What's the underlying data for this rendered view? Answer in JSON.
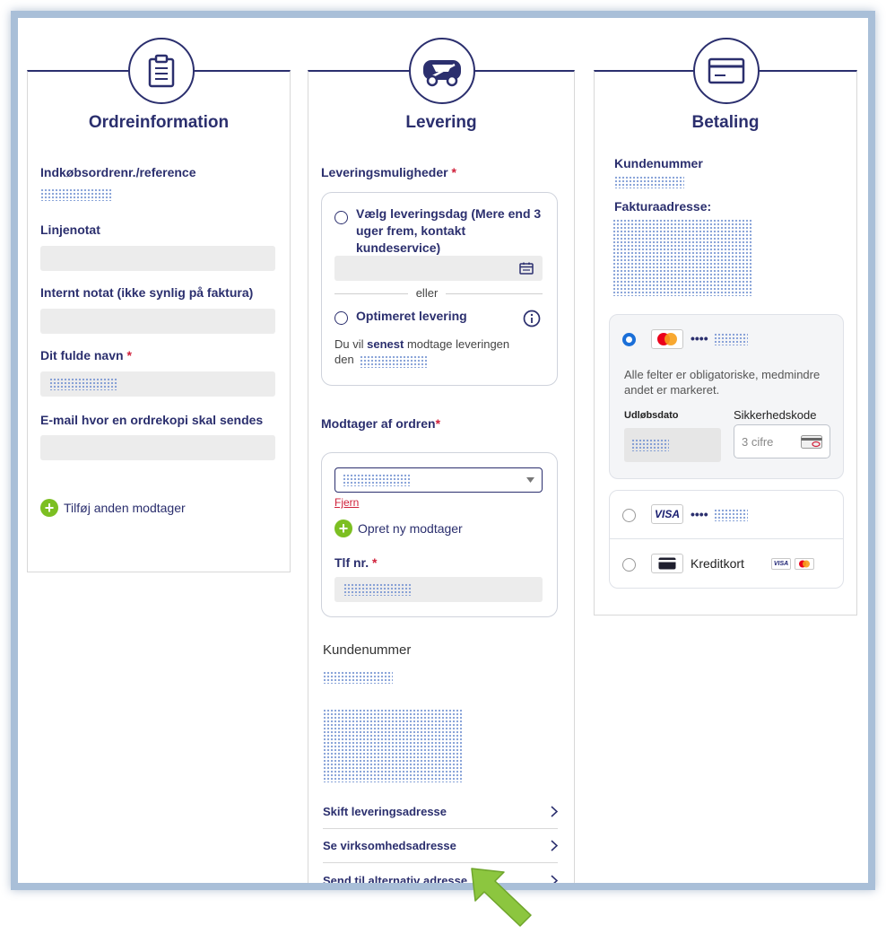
{
  "ordre": {
    "title": "Ordreinformation",
    "icon": "clipboard-icon",
    "po_label": "Indkøbsordrenr./reference",
    "line_note_label": "Linjenotat",
    "internal_note_label": "Internt notat (ikke synlig på faktura)",
    "name_label": "Dit fulde navn",
    "required_mark": "*",
    "email_label": "E-mail hvor en ordrekopi skal sendes",
    "add_recipient": "Tilføj anden modtager"
  },
  "levering": {
    "title": "Levering",
    "icon": "delivery-van-icon",
    "options_label": "Leveringsmuligheder",
    "required_mark": "*",
    "option_day": "Vælg leveringsdag (Mere end 3 uger frem, kontakt kundeservice)",
    "divider": "eller",
    "option_optimized": "Optimeret levering",
    "latest_prefix": "Du vil ",
    "latest_bold": "senest",
    "latest_suffix": " modtage leveringen",
    "latest_line2": "den",
    "recipient_label": "Modtager af ordren",
    "remove_link": "Fjern",
    "new_recipient": "Opret ny modtager",
    "phone_label": "Tlf nr.",
    "customer_no_label": "Kundenummer",
    "links": [
      "Skift leveringsadresse",
      "Se virksomhedsadresse",
      "Send til alternativ adresse"
    ]
  },
  "betaling": {
    "title": "Betaling",
    "icon": "credit-card-icon",
    "customer_no_label": "Kundenummer",
    "invoice_address_label": "Fakturaadresse:",
    "card_dots": "••••",
    "mandatory_note": "Alle felter er obligatoriske, medmindre andet er markeret.",
    "expiry_label": "Udløbsdato",
    "cvc_label": "Sikkerhedskode",
    "cvc_placeholder": "3 cifre",
    "visa_label": "VISA",
    "credit_card_label": "Kreditkort"
  },
  "colors": {
    "navy": "#2b2f6e",
    "green": "#7cbf22",
    "required": "#d0203a",
    "selected_radio": "#1a6fd8"
  }
}
